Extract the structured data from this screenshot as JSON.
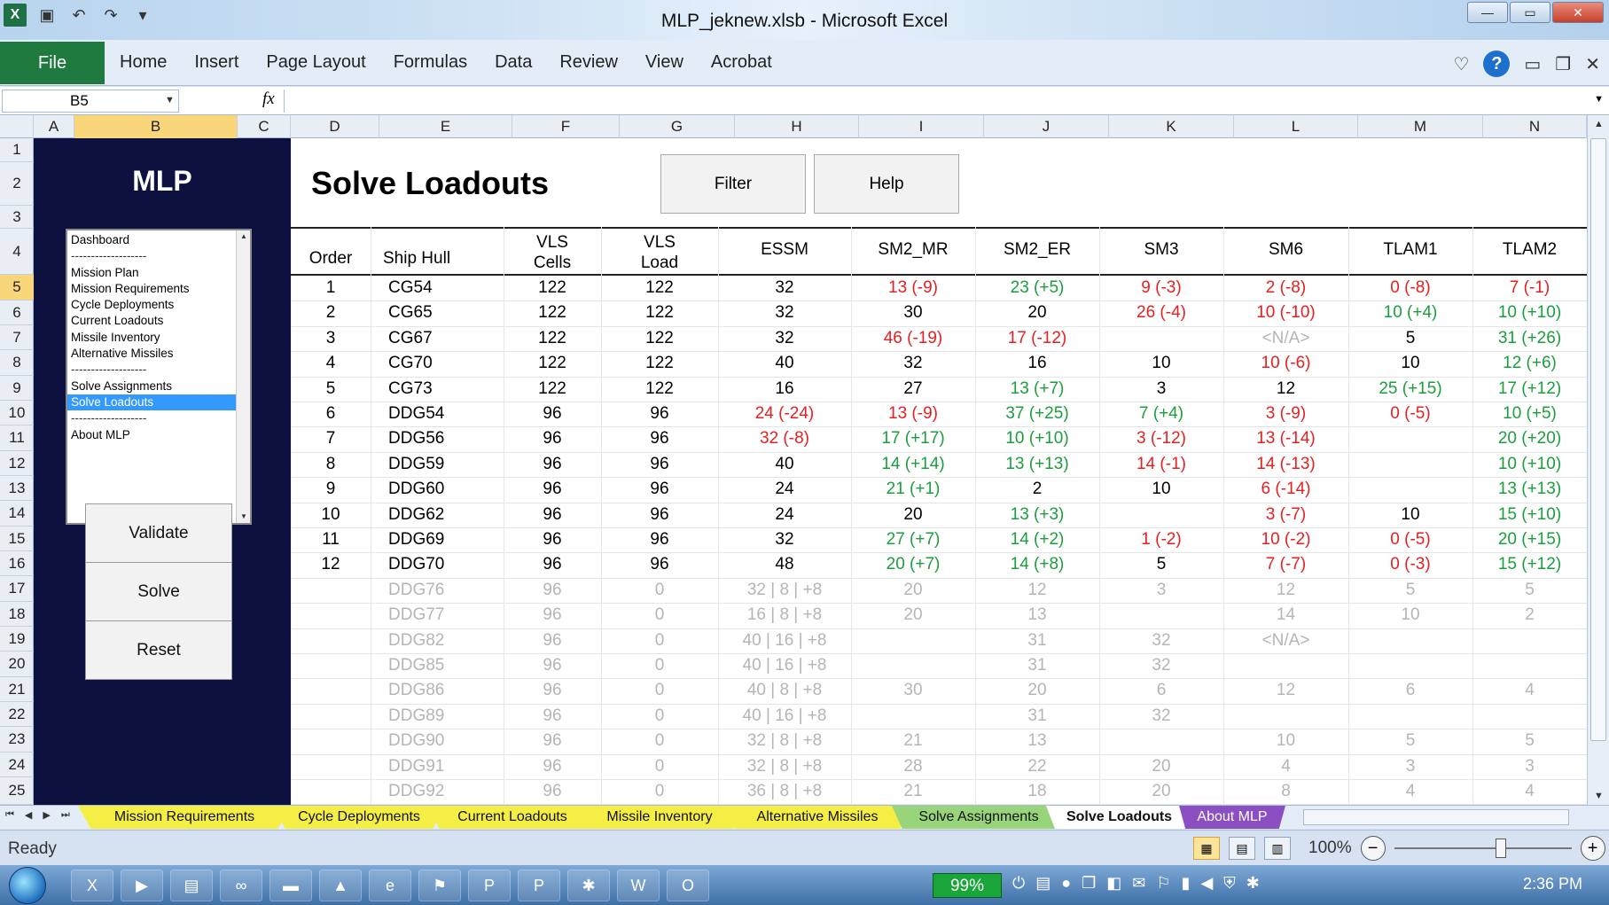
{
  "window": {
    "title": "MLP_jeknew.xlsb - Microsoft Excel",
    "minimize": "—",
    "maximize": "▭",
    "close": "✕"
  },
  "ribbon": {
    "file": "File",
    "tabs": [
      "Home",
      "Insert",
      "Page Layout",
      "Formulas",
      "Data",
      "Review",
      "View",
      "Acrobat"
    ]
  },
  "formula_bar": {
    "name_box": "B5",
    "fx": "fx",
    "value": ""
  },
  "columns": [
    "A",
    "B",
    "C",
    "D",
    "E",
    "F",
    "G",
    "H",
    "I",
    "J",
    "K",
    "L",
    "M",
    "N"
  ],
  "rows": [
    "1",
    "2",
    "3",
    "4",
    "5",
    "6",
    "7",
    "8",
    "9",
    "10",
    "11",
    "12",
    "13",
    "14",
    "15",
    "16",
    "17",
    "18",
    "19",
    "20",
    "21",
    "22",
    "23",
    "24",
    "25"
  ],
  "nav": {
    "title": "MLP",
    "items": [
      {
        "label": "Dashboard",
        "type": "item"
      },
      {
        "label": "-------------------",
        "type": "sep"
      },
      {
        "label": "Mission Plan",
        "type": "item"
      },
      {
        "label": "Mission Requirements",
        "type": "item"
      },
      {
        "label": "Cycle Deployments",
        "type": "item"
      },
      {
        "label": "Current Loadouts",
        "type": "item"
      },
      {
        "label": "Missile Inventory",
        "type": "item"
      },
      {
        "label": "Alternative Missiles",
        "type": "item"
      },
      {
        "label": "-------------------",
        "type": "sep"
      },
      {
        "label": "Solve Assignments",
        "type": "item"
      },
      {
        "label": "Solve Loadouts",
        "type": "active"
      },
      {
        "label": "-------------------",
        "type": "sep"
      },
      {
        "label": "About MLP",
        "type": "item"
      }
    ],
    "buttons": {
      "validate": "Validate",
      "solve": "Solve",
      "reset": "Reset"
    }
  },
  "page": {
    "title": "Solve Loadouts",
    "filter_button": "Filter",
    "help_button": "Help"
  },
  "table": {
    "headers": [
      [
        "Order"
      ],
      [
        "Ship Hull"
      ],
      [
        "VLS",
        "Cells"
      ],
      [
        "VLS",
        "Load"
      ],
      [
        "ESSM"
      ],
      [
        "SM2_MR"
      ],
      [
        "SM2_ER"
      ],
      [
        "SM3"
      ],
      [
        "SM6"
      ],
      [
        "TLAM1"
      ],
      [
        "TLAM2"
      ]
    ],
    "rows": [
      {
        "cells": [
          "1",
          "CG54",
          "122",
          "122",
          "32",
          "13 (-9)",
          "23 (+5)",
          "9 (-3)",
          "2 (-8)",
          "0 (-8)",
          "7 (-1)"
        ],
        "colors": [
          "k",
          "k",
          "k",
          "k",
          "k",
          "r",
          "g",
          "r",
          "r",
          "r",
          "r"
        ]
      },
      {
        "cells": [
          "2",
          "CG65",
          "122",
          "122",
          "32",
          "30",
          "20",
          "26 (-4)",
          "10 (-10)",
          "10 (+4)",
          "10 (+10)"
        ],
        "colors": [
          "k",
          "k",
          "k",
          "k",
          "k",
          "k",
          "k",
          "r",
          "r",
          "g",
          "g"
        ]
      },
      {
        "cells": [
          "3",
          "CG67",
          "122",
          "122",
          "32",
          "46 (-19)",
          "17 (-12)",
          "",
          "<N/A>",
          "5",
          "31 (+26)"
        ],
        "colors": [
          "k",
          "k",
          "k",
          "k",
          "k",
          "r",
          "r",
          "k",
          "gray",
          "k",
          "g"
        ]
      },
      {
        "cells": [
          "4",
          "CG70",
          "122",
          "122",
          "40",
          "32",
          "16",
          "10",
          "10 (-6)",
          "10",
          "12 (+6)"
        ],
        "colors": [
          "k",
          "k",
          "k",
          "k",
          "k",
          "k",
          "k",
          "k",
          "r",
          "k",
          "g"
        ]
      },
      {
        "cells": [
          "5",
          "CG73",
          "122",
          "122",
          "16",
          "27",
          "13 (+7)",
          "3",
          "12",
          "25 (+15)",
          "17 (+12)"
        ],
        "colors": [
          "k",
          "k",
          "k",
          "k",
          "k",
          "k",
          "g",
          "k",
          "k",
          "g",
          "g"
        ]
      },
      {
        "cells": [
          "6",
          "DDG54",
          "96",
          "96",
          "24 (-24)",
          "13 (-9)",
          "37 (+25)",
          "7 (+4)",
          "3 (-9)",
          "0 (-5)",
          "10 (+5)"
        ],
        "colors": [
          "k",
          "k",
          "k",
          "k",
          "r",
          "r",
          "g",
          "g",
          "r",
          "r",
          "g"
        ]
      },
      {
        "cells": [
          "7",
          "DDG56",
          "96",
          "96",
          "32 (-8)",
          "17 (+17)",
          "10 (+10)",
          "3 (-12)",
          "13 (-14)",
          "",
          "20 (+20)"
        ],
        "colors": [
          "k",
          "k",
          "k",
          "k",
          "r",
          "g",
          "g",
          "r",
          "r",
          "k",
          "g"
        ]
      },
      {
        "cells": [
          "8",
          "DDG59",
          "96",
          "96",
          "40",
          "14 (+14)",
          "13 (+13)",
          "14 (-1)",
          "14 (-13)",
          "",
          "10 (+10)"
        ],
        "colors": [
          "k",
          "k",
          "k",
          "k",
          "k",
          "g",
          "g",
          "r",
          "r",
          "k",
          "g"
        ]
      },
      {
        "cells": [
          "9",
          "DDG60",
          "96",
          "96",
          "24",
          "21 (+1)",
          "2",
          "10",
          "6 (-14)",
          "",
          "13 (+13)"
        ],
        "colors": [
          "k",
          "k",
          "k",
          "k",
          "k",
          "g",
          "k",
          "k",
          "r",
          "k",
          "g"
        ]
      },
      {
        "cells": [
          "10",
          "DDG62",
          "96",
          "96",
          "24",
          "20",
          "13 (+3)",
          "",
          "3 (-7)",
          "10",
          "15 (+10)"
        ],
        "colors": [
          "k",
          "k",
          "k",
          "k",
          "k",
          "k",
          "g",
          "k",
          "r",
          "k",
          "g"
        ]
      },
      {
        "cells": [
          "11",
          "DDG69",
          "96",
          "96",
          "32",
          "27 (+7)",
          "14 (+2)",
          "1 (-2)",
          "10 (-2)",
          "0 (-5)",
          "20 (+15)"
        ],
        "colors": [
          "k",
          "k",
          "k",
          "k",
          "k",
          "g",
          "g",
          "r",
          "r",
          "r",
          "g"
        ]
      },
      {
        "cells": [
          "12",
          "DDG70",
          "96",
          "96",
          "48",
          "20 (+7)",
          "14 (+8)",
          "5",
          "7 (-7)",
          "0 (-3)",
          "15 (+12)"
        ],
        "colors": [
          "k",
          "k",
          "k",
          "k",
          "k",
          "g",
          "g",
          "k",
          "r",
          "r",
          "g"
        ]
      },
      {
        "cells": [
          "",
          "DDG76",
          "96",
          "0",
          "32 | 8 | +8",
          "20",
          "12",
          "3",
          "12",
          "5",
          "5"
        ],
        "colors": [
          "gray",
          "gray",
          "gray",
          "gray",
          "gray",
          "gray",
          "gray",
          "gray",
          "gray",
          "gray",
          "gray"
        ]
      },
      {
        "cells": [
          "",
          "DDG77",
          "96",
          "0",
          "16 | 8 | +8",
          "20",
          "13",
          "",
          "14",
          "10",
          "2"
        ],
        "colors": [
          "gray",
          "gray",
          "gray",
          "gray",
          "gray",
          "gray",
          "gray",
          "gray",
          "gray",
          "gray",
          "gray"
        ]
      },
      {
        "cells": [
          "",
          "DDG82",
          "96",
          "0",
          "40 | 16 | +8",
          "",
          "31",
          "32",
          "<N/A>",
          "",
          ""
        ],
        "colors": [
          "gray",
          "gray",
          "gray",
          "gray",
          "gray",
          "gray",
          "gray",
          "gray",
          "gray",
          "gray",
          "gray"
        ]
      },
      {
        "cells": [
          "",
          "DDG85",
          "96",
          "0",
          "40 | 16 | +8",
          "",
          "31",
          "32",
          "",
          "",
          ""
        ],
        "colors": [
          "gray",
          "gray",
          "gray",
          "gray",
          "gray",
          "gray",
          "gray",
          "gray",
          "gray",
          "gray",
          "gray"
        ]
      },
      {
        "cells": [
          "",
          "DDG86",
          "96",
          "0",
          "40 | 8 | +8",
          "30",
          "20",
          "6",
          "12",
          "6",
          "4"
        ],
        "colors": [
          "gray",
          "gray",
          "gray",
          "gray",
          "gray",
          "gray",
          "gray",
          "gray",
          "gray",
          "gray",
          "gray"
        ]
      },
      {
        "cells": [
          "",
          "DDG89",
          "96",
          "0",
          "40 | 16 | +8",
          "",
          "31",
          "32",
          "",
          "",
          ""
        ],
        "colors": [
          "gray",
          "gray",
          "gray",
          "gray",
          "gray",
          "gray",
          "gray",
          "gray",
          "gray",
          "gray",
          "gray"
        ]
      },
      {
        "cells": [
          "",
          "DDG90",
          "96",
          "0",
          "32 | 8 | +8",
          "21",
          "13",
          "",
          "10",
          "5",
          "5"
        ],
        "colors": [
          "gray",
          "gray",
          "gray",
          "gray",
          "gray",
          "gray",
          "gray",
          "gray",
          "gray",
          "gray",
          "gray"
        ]
      },
      {
        "cells": [
          "",
          "DDG91",
          "96",
          "0",
          "32 | 8 | +8",
          "28",
          "22",
          "20",
          "4",
          "3",
          "3"
        ],
        "colors": [
          "gray",
          "gray",
          "gray",
          "gray",
          "gray",
          "gray",
          "gray",
          "gray",
          "gray",
          "gray",
          "gray"
        ]
      },
      {
        "cells": [
          "",
          "DDG92",
          "96",
          "0",
          "36 | 8 | +8",
          "21",
          "18",
          "20",
          "8",
          "4",
          "4"
        ],
        "colors": [
          "gray",
          "gray",
          "gray",
          "gray",
          "gray",
          "gray",
          "gray",
          "gray",
          "gray",
          "gray",
          "gray"
        ]
      }
    ]
  },
  "sheet_tabs": [
    {
      "label": "Mission Requirements",
      "style": "yellow"
    },
    {
      "label": "Cycle Deployments",
      "style": "yellow"
    },
    {
      "label": "Current Loadouts",
      "style": "yellow"
    },
    {
      "label": "Missile Inventory",
      "style": "yellow"
    },
    {
      "label": "Alternative Missiles",
      "style": "yellow"
    },
    {
      "label": "Solve Assignments",
      "style": "green"
    },
    {
      "label": "Solve Loadouts",
      "style": "active"
    },
    {
      "label": "About MLP",
      "style": "purple"
    }
  ],
  "status": {
    "ready": "Ready",
    "zoom": "100%"
  },
  "taskbar": {
    "battery": "99%",
    "clock": "2:36 PM"
  },
  "colors": {
    "nav_bg": "#0d1140",
    "positive": "#1a9f3c",
    "negative": "#e62020",
    "inactive": "#b5b5b5",
    "file_tab": "#1f7a3f"
  }
}
